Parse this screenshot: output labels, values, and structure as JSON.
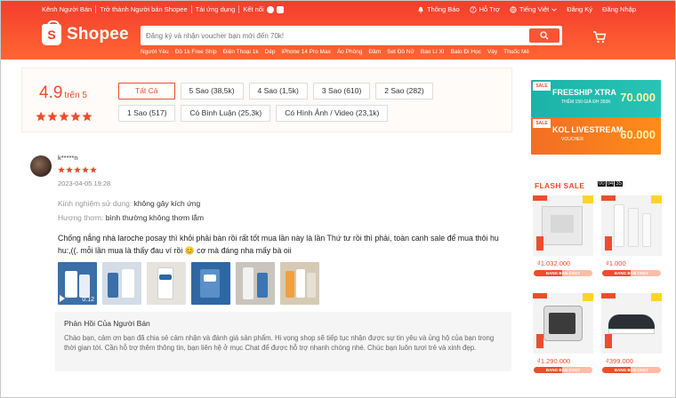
{
  "topbar": {
    "left": [
      "Kênh Người Bán",
      "Trở thành Người bán Shopee",
      "Tải ứng dụng",
      "Kết nối"
    ],
    "right": [
      "Thông Báo",
      "Hỗ Trợ",
      "Tiếng Việt",
      "Đăng Ký",
      "Đăng Nhập"
    ]
  },
  "brand": "Shopee",
  "search": {
    "placeholder": "Đăng ký và nhận voucher bạn mới đến 70k!"
  },
  "suggestions": [
    "Người Yêu",
    "Đồ 1k Free Ship",
    "Điện Thoại 1k",
    "Dép",
    "iPhone 14 Pro Max",
    "Áo Phông",
    "Đầm",
    "Set Đồ Nữ",
    "Bao Lì Xì",
    "Balo Đi Học",
    "Váy",
    "Thuốc Mê"
  ],
  "summary": {
    "score": "4.9",
    "score_suffix": "trên 5",
    "rating_stars": 5,
    "filters": [
      "Tất Cả",
      "5 Sao (38,5k)",
      "4 Sao (1,5k)",
      "3 Sao (610)",
      "2 Sao (282)",
      "1 Sao (517)",
      "Có Bình Luận (25,3k)",
      "Có Hình Ảnh / Video (23,1k)"
    ]
  },
  "review": {
    "username": "k*****n",
    "stars": 5,
    "date": "2023-04-05 19:28",
    "attr1_key": "Kinh nghiệm sử dụng:",
    "attr1_val": "không gây kích ứng",
    "attr2_key": "Hương thơm:",
    "attr2_val": "bình thường không thơm lắm",
    "content": "Chống nắng nhà laroche posay thì khỏi phải bàn rồi rất tốt mua lần này là lần Thứ tư rồi thì phải, toàn canh sale để mua thôi hu hu:,((. mỗi lần mua là thấy đau ví rồi 😊 cơ mà đáng nha mấy bà oii",
    "video_duration": "0:12",
    "media_colors": [
      "#3a6fa8",
      "#d4dce6",
      "#e6e3dc",
      "#2f67a3",
      "#c9c4bc",
      "#d6cab5"
    ]
  },
  "seller_reply": {
    "title": "Phản Hồi Của Người Bán",
    "body": "Chào bạn, cảm ơn bạn đã chia sẻ cảm nhận và đánh giá sản phẩm. Hi vọng shop sẽ tiếp tục nhận được sự tin yêu và ủng hộ của bạn trong thời gian tới. Cần hỗ trợ thêm thông tin, bạn liên hệ ở mục Chat để được hỗ trợ nhanh chóng nhé. Chúc bạn luôn tươi trẻ và xinh đẹp."
  },
  "banners": [
    {
      "tag": "SALE",
      "title": "FREESHIP XTRA",
      "sub": "THÊM 150 GIẢ ĐH 350K",
      "big": "70.000"
    },
    {
      "tag": "SALE",
      "title": "KOL LIVESTREAM",
      "sub": "VOUCHER",
      "big": "60.000"
    }
  ],
  "flash_sale": {
    "title": "FLASH SALE",
    "timer": [
      "00",
      "04",
      "35"
    ],
    "products": [
      {
        "price": "₫1.032.000",
        "status": "ĐANG BÁN CHẠY"
      },
      {
        "price": "₫1.000",
        "status": "ĐANG BÁN CHẠY"
      },
      {
        "price": "₫1.290.000",
        "status": "ĐANG BÁN CHẠY"
      },
      {
        "price": "₫399.000",
        "status": "ĐANG BÁN CHẠY"
      }
    ]
  },
  "colors": {
    "brand": "#ee4d2d",
    "header": "#f53d2d"
  }
}
